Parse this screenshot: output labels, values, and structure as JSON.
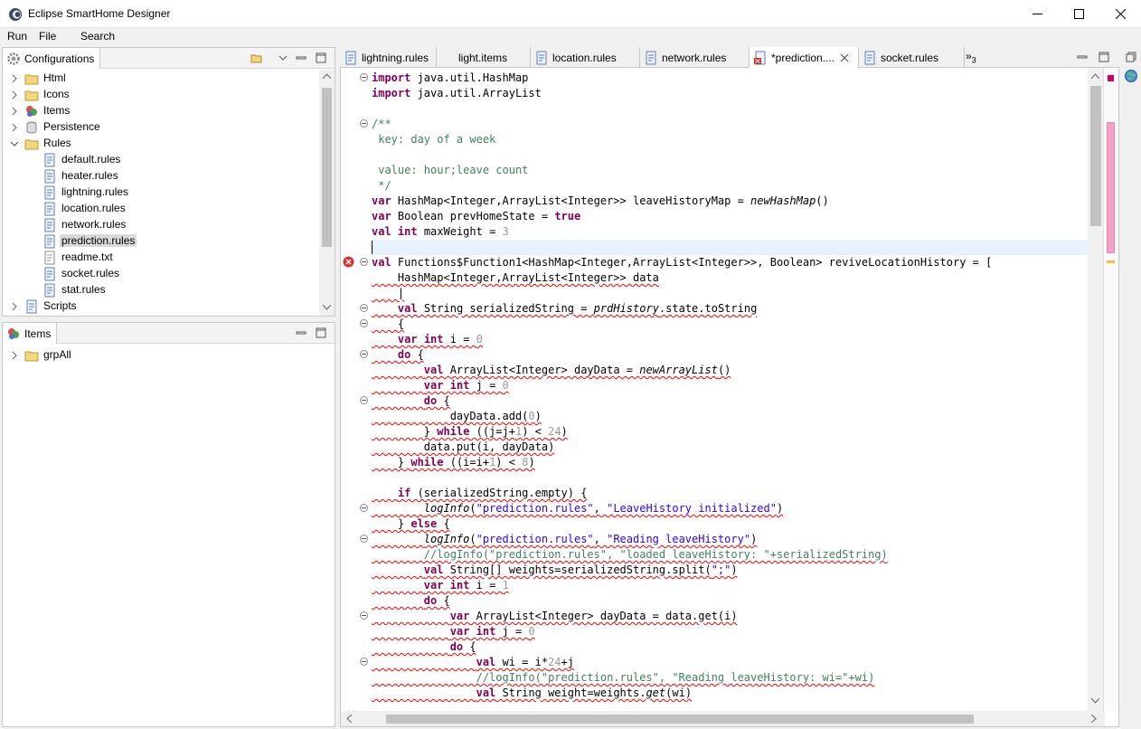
{
  "window": {
    "title": "Eclipse SmartHome Designer",
    "app_icon": "eclipse-smarthome-icon"
  },
  "menu": {
    "items": [
      "Run",
      "File",
      "Search"
    ]
  },
  "configurations": {
    "tab_label": "Configurations",
    "tree": [
      {
        "label": "Html",
        "icon": "folder-icon",
        "expanded": false
      },
      {
        "label": "Icons",
        "icon": "folder-icon",
        "expanded": false
      },
      {
        "label": "Items",
        "icon": "items-icon",
        "expanded": false
      },
      {
        "label": "Persistence",
        "icon": "database-icon",
        "expanded": false
      },
      {
        "label": "Rules",
        "icon": "folder-icon",
        "expanded": true
      },
      {
        "label": "default.rules",
        "icon": "rules-file-icon"
      },
      {
        "label": "heater.rules",
        "icon": "rules-file-icon"
      },
      {
        "label": "lightning.rules",
        "icon": "rules-file-icon"
      },
      {
        "label": "location.rules",
        "icon": "rules-file-icon"
      },
      {
        "label": "network.rules",
        "icon": "rules-file-icon"
      },
      {
        "label": "prediction.rules",
        "icon": "rules-file-icon",
        "selected": true
      },
      {
        "label": "readme.txt",
        "icon": "text-file-icon"
      },
      {
        "label": "socket.rules",
        "icon": "rules-file-icon"
      },
      {
        "label": "stat.rules",
        "icon": "rules-file-icon"
      },
      {
        "label": "Scripts",
        "icon": "scripts-icon",
        "expanded": false
      }
    ]
  },
  "items_view": {
    "tab_label": "Items",
    "tree": [
      {
        "label": "grpAll",
        "icon": "folder-icon",
        "expanded": false
      }
    ]
  },
  "editor": {
    "tabs": [
      {
        "label": "lightning.rules",
        "active": false
      },
      {
        "label": "light.items",
        "active": false
      },
      {
        "label": "location.rules",
        "active": false
      },
      {
        "label": "network.rules",
        "active": false
      },
      {
        "label": "*prediction....",
        "active": true,
        "closable": true
      },
      {
        "label": "socket.rules",
        "active": false
      }
    ],
    "overflow_label": "»",
    "overflow_count": "3",
    "lines": [
      "import java.util.HashMap",
      "import java.util.ArrayList",
      "",
      "/**",
      " key: day of a week",
      "",
      " value: hour;leave count",
      " */",
      "var HashMap<Integer,ArrayList<Integer>> leaveHistoryMap = newHashMap()",
      "var Boolean prevHomeState = true",
      "val int maxWeight = 3",
      "",
      "val Functions$Function1<HashMap<Integer,ArrayList<Integer>>, Boolean> reviveLocationHistory = [",
      "    HashMap<Integer,ArrayList<Integer>> data",
      "    |",
      "    val String serializedString = prdHistory.state.toString",
      "    {",
      "    var int i = 0",
      "    do {",
      "        val ArrayList<Integer> dayData = newArrayList()",
      "        var int j = 0",
      "        do {",
      "            dayData.add(0)",
      "        } while ((j=j+1) < 24)",
      "        data.put(i, dayData)",
      "    } while ((i=i+1) < 8)",
      "",
      "    if (serializedString.empty) {",
      "        logInfo(\"prediction.rules\", \"LeaveHistory initialized\")",
      "    } else {",
      "        logInfo(\"prediction.rules\", \"Reading leaveHistory\")",
      "        //logInfo(\"prediction.rules\", \"loaded leaveHistory: \"+serializedString)",
      "        val String[] weights=serializedString.split(\";\")",
      "        var int i = 1",
      "        do {",
      "            var ArrayList<Integer> dayData = data.get(i)",
      "            var int j = 0",
      "            do {",
      "                val wi = i*24+j",
      "                //logInfo(\"prediction.rules\", \"Reading leaveHistory: wi=\"+wi)",
      "                val String weight=weights.get(wi)"
    ]
  }
}
